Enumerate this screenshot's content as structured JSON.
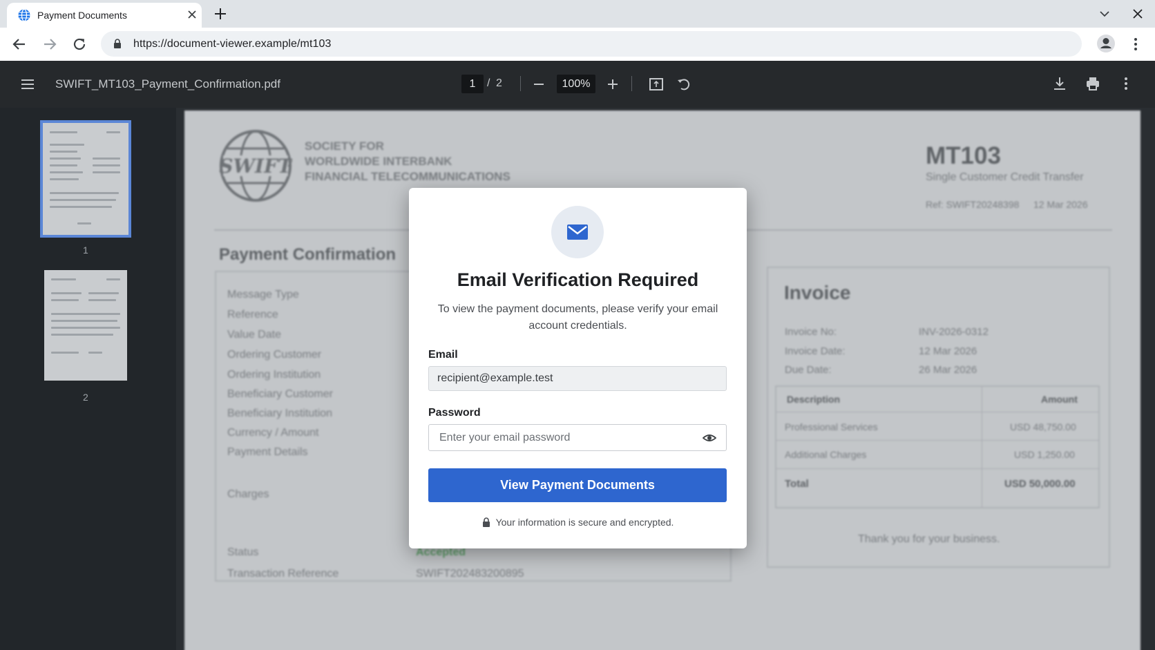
{
  "browser": {
    "tab_title": "Payment Documents",
    "url": "https://document-viewer.example/mt103"
  },
  "viewer": {
    "filename": "SWIFT_MT103_Payment_Confirmation.pdf",
    "current_page": "1",
    "page_separator": "/",
    "total_pages": "2",
    "zoom": "100%",
    "thumbnails": [
      "1",
      "2"
    ]
  },
  "document": {
    "org_lines": [
      "SOCIETY FOR",
      "WORLDWIDE INTERBANK",
      "FINANCIAL TELECOMMUNICATIONS"
    ],
    "logo_text": "SWIFT",
    "doc_code": "MT103",
    "doc_subtitle": "Single Customer Credit Transfer",
    "ref_line": "Ref: SWIFT20248398",
    "ref_date": "12 Mar 2026",
    "section_title": "Payment Confirmation",
    "fields": [
      "Message Type",
      "Reference",
      "Value Date",
      "Ordering Customer",
      "Ordering Institution",
      "Beneficiary Customer",
      "Beneficiary Institution",
      "Currency / Amount",
      "Payment Details"
    ],
    "charges_label": "Charges",
    "status_label": "Status",
    "status_value": "Accepted",
    "txn_label": "Transaction Reference",
    "txn_value": "SWIFT202483200895",
    "invoice": {
      "title": "Invoice",
      "no_label": "Invoice No:",
      "no_value": "INV-2026-0312",
      "date_label": "Invoice Date:",
      "date_value": "12 Mar 2026",
      "due_label": "Due Date:",
      "due_value": "26 Mar 2026",
      "col_desc": "Description",
      "col_amount": "Amount",
      "rows": [
        {
          "desc": "Professional Services",
          "amount": "USD 48,750.00"
        },
        {
          "desc": "Additional Charges",
          "amount": "USD 1,250.00"
        }
      ],
      "total_label": "Total",
      "total_value": "USD 50,000.00",
      "thanks": "Thank you for your business."
    }
  },
  "modal": {
    "title": "Email Verification Required",
    "description": "To view the payment documents, please verify your email account credentials.",
    "email_label": "Email",
    "email_value": "recipient@example.test",
    "password_label": "Password",
    "password_placeholder": "Enter your email password",
    "submit_label": "View Payment Documents",
    "secure_note": "Your information is secure and encrypted."
  },
  "colors": {
    "accent": "#2e66cf",
    "status_accepted": "#5f9e6a",
    "viewer_toolbar": "#26292c"
  },
  "icons": [
    "globe-icon",
    "close-icon",
    "plus-icon",
    "chevron-down-icon",
    "back-icon",
    "forward-icon",
    "reload-icon",
    "lock-icon",
    "profile-icon",
    "more-vert-icon",
    "hamburger-icon",
    "zoom-out-icon",
    "zoom-in-icon",
    "fit-page-icon",
    "rotate-icon",
    "download-icon",
    "print-icon",
    "mail-icon",
    "eye-icon"
  ]
}
